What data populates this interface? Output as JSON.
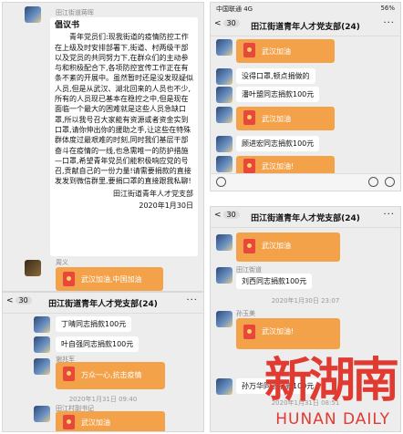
{
  "p1": {
    "sender": "田江街道蒋晖",
    "doc_title": "倡议书",
    "doc_body": "青年党员们:现我街道的疫情防控工作在上级及时安排部署下,街道、村两级干部以及党员的共同努力下,在群众们的主动参与和积极配合下,各项防控宣传工作正在有条不紊的开展中。虽然暂时还是没发现疑似人员,但是从武汉、湖北回来的人员也不少,所有的人员现已基本在稳控之中,但是现在面临一个最大的困难就是这些人员急缺口罩,所以我号召大家能有资源或者资金实到口罩,请你伸出你的援助之手,让这些在特殊群体度过最艰难的时刻,同时我们基层干部奋斗在疫情的一线,也急需唯一的防护措施—口罩,希望青年党员们能积极响应党的号召,贡献自己的一份力量!请需要捐款的直接发发到微信群里,要捐口罩的直接跟我私聊!",
    "doc_sign": "田江街道青年人才党支部",
    "doc_date": "2020年1月30日",
    "sender2": "周义",
    "packet_text": "武汉加油,中国加油"
  },
  "p2": {
    "status_left": "中国联通 4G",
    "status_right": "56%",
    "back": "<",
    "badge": "30",
    "title": "田江街道青年人才党支部(24)",
    "more": "···",
    "items": [
      {
        "kind": "packet",
        "text": "武汉加油"
      },
      {
        "kind": "text",
        "sender": "",
        "text": "没得口罩,顿点捐做的"
      },
      {
        "kind": "text",
        "sender": "",
        "text": "潘叶盟同志捐款100元"
      },
      {
        "kind": "packet",
        "text": "武汉加油"
      },
      {
        "kind": "text",
        "sender": "",
        "text": "顾进宏同志捐款100元"
      },
      {
        "kind": "packet",
        "text": "武汉加油!"
      }
    ]
  },
  "p3": {
    "back": "<",
    "badge": "30",
    "title": "田江街道青年人才党支部(24)",
    "more": "···",
    "items": [
      {
        "kind": "packet",
        "text": "武汉加油"
      },
      {
        "kind": "text",
        "sender": "田江街道",
        "text": "刘西同志捐款100元"
      },
      {
        "kind": "time",
        "text": "2020年1月30日 23:07"
      },
      {
        "kind": "packet",
        "text": "武汉加油!",
        "sender": "孙玉美"
      },
      {
        "kind": "text",
        "sender": "",
        "text": "孙万华同志捐款100元"
      },
      {
        "kind": "time",
        "text": "2020年1月31日 08:51"
      }
    ]
  },
  "p4": {
    "back": "<",
    "badge": "30",
    "title": "田江街道青年人才党支部(24)",
    "more": "···",
    "items": [
      {
        "kind": "text",
        "text": "丁晴同志捐款100元"
      },
      {
        "kind": "text",
        "text": "叶自强同志捐款100元"
      },
      {
        "kind": "packet",
        "text": "万众一心,抗击疫情",
        "sender": "谢兆军"
      },
      {
        "kind": "time",
        "text": "2020年1月31日 09:40"
      },
      {
        "kind": "packet",
        "text": "武汉加油",
        "sender": "田江村副书记"
      }
    ]
  },
  "watermark": {
    "cn": "新湖南",
    "en": "HUNAN DAILY"
  }
}
